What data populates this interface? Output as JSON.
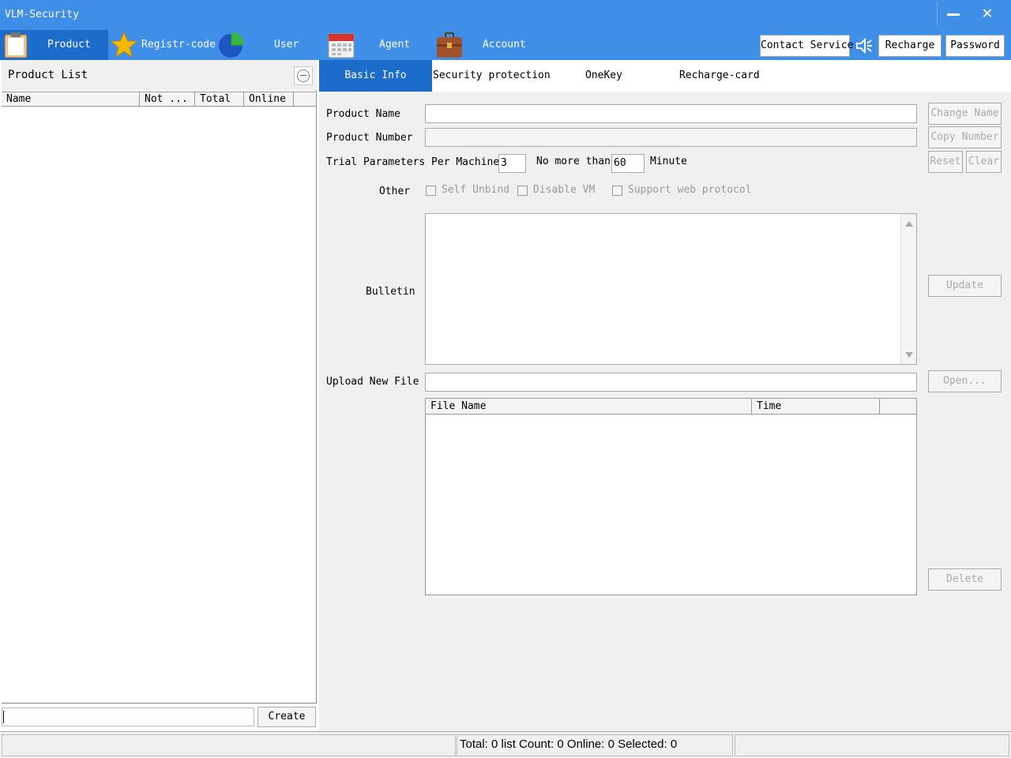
{
  "window": {
    "title": "VLM-Security"
  },
  "nav": [
    {
      "label": "Product",
      "icon": "clipboard-icon",
      "active": true
    },
    {
      "label": "Registr-code",
      "icon": "star-icon",
      "active": false
    },
    {
      "label": "User",
      "icon": "pie-chart-icon",
      "active": false
    },
    {
      "label": "Agent",
      "icon": "calendar-icon",
      "active": false
    },
    {
      "label": "Account",
      "icon": "briefcase-icon",
      "active": false
    }
  ],
  "topbar": {
    "contact": "Contact Service",
    "recharge": "Recharge",
    "password": "Password"
  },
  "product_list": {
    "title": "Product List",
    "columns": [
      "Name",
      "Not ...",
      "Total",
      "Online"
    ],
    "rows": [],
    "new_name_value": "",
    "create_label": "Create"
  },
  "tabs": [
    "Basic Info",
    "Security protection",
    "OneKey",
    "Recharge-card"
  ],
  "form": {
    "product_name_label": "Product Name",
    "product_name_value": "",
    "product_number_label": "Product Number",
    "product_number_value": "",
    "trial_label": "Trial Parameters Per Machine",
    "trial_value": "3",
    "no_more_than_label": "No more than",
    "minutes_value": "60",
    "minute_label": "Minute",
    "other_label": "Other",
    "options": [
      "Self Unbind",
      "Disable VM",
      "Support web protocol"
    ],
    "bulletin_label": "Bulletin",
    "bulletin_value": "",
    "upload_label": "Upload New File",
    "upload_value": "",
    "file_columns": [
      "File Name",
      "Time"
    ]
  },
  "buttons": {
    "change_name": "Change Name",
    "copy_number": "Copy Number",
    "reset": "Reset",
    "clear": "Clear",
    "update": "Update",
    "open": "Open...",
    "delete": "Delete"
  },
  "status": {
    "text": "Total: 0 list Count: 0 Online: 0 Selected: 0"
  },
  "colors": {
    "header_blue": "#3f8fe8",
    "active_blue": "#1c6ccc"
  }
}
